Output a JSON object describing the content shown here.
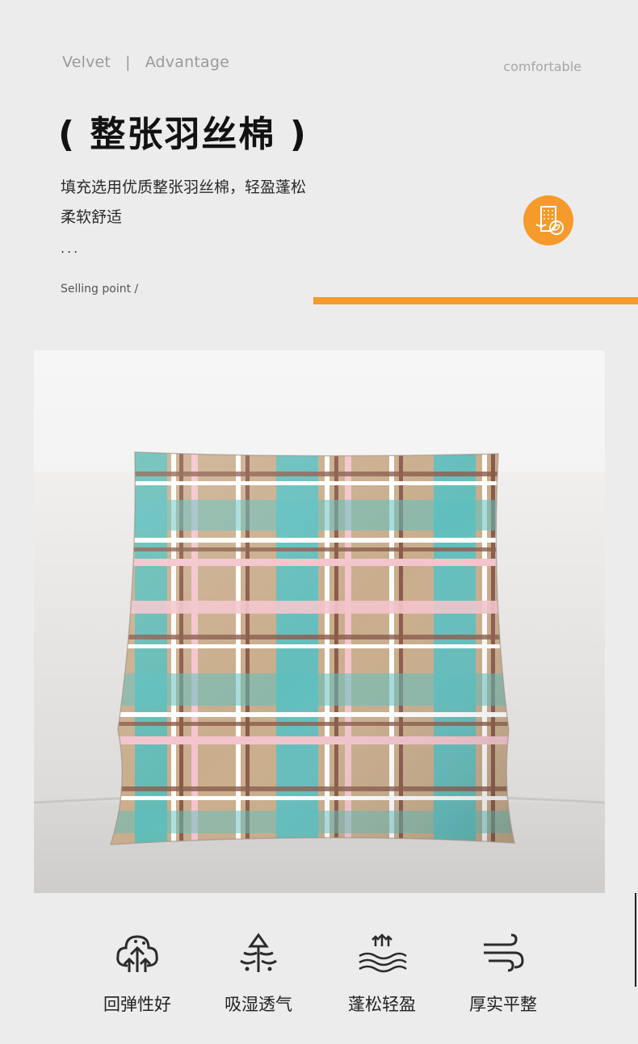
{
  "header": {
    "tag_left": "Velvet",
    "tag_separator": "|",
    "tag_mid": "Advantage",
    "tag_right": "comfortable"
  },
  "title": "( 整张羽丝棉 )",
  "description": {
    "line1": "填充选用优质整张羽丝棉，轻盈蓬松",
    "line2": "柔软舒适"
  },
  "ellipsis": "...",
  "selling_point": "Selling point /",
  "badge_icon": "padding-sheet-leaf-icon",
  "colors": {
    "accent": "#f59a2b",
    "background": "#ececec"
  },
  "photo": {
    "subject": "plaid-cushion-on-sofa",
    "plaid_colors": [
      "#c9ad8c",
      "#5bbfc0",
      "#f3c4cc",
      "#8a5a4a",
      "#ffffff"
    ]
  },
  "features": [
    {
      "label": "回弹性好",
      "icon": "rebound-tree-icon"
    },
    {
      "label": "吸湿透气",
      "icon": "moisture-breathable-icon"
    },
    {
      "label": "蓬松轻盈",
      "icon": "fluffy-waves-icon"
    },
    {
      "label": "厚实平整",
      "icon": "wind-lines-icon"
    }
  ]
}
